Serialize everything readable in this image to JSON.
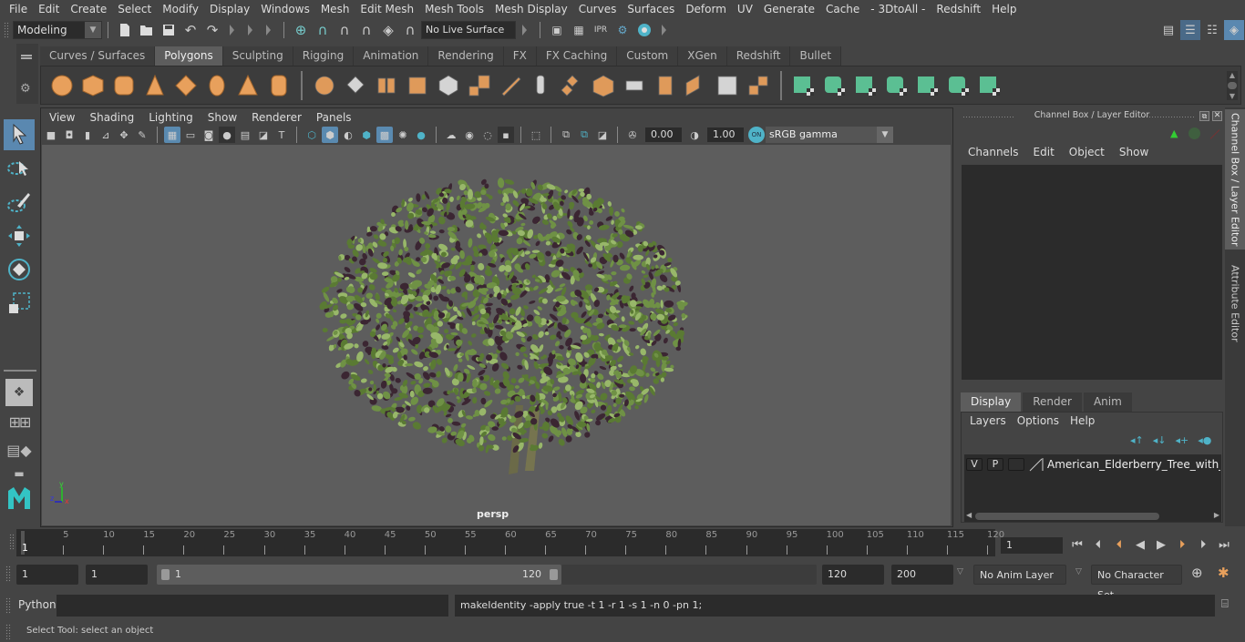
{
  "menubar": {
    "items": [
      "File",
      "Edit",
      "Create",
      "Select",
      "Modify",
      "Display",
      "Windows",
      "Mesh",
      "Edit Mesh",
      "Mesh Tools",
      "Mesh Display",
      "Curves",
      "Surfaces",
      "Deform",
      "UV",
      "Generate",
      "Cache",
      "- 3DtoAll -",
      "Redshift",
      "Help"
    ]
  },
  "statusline": {
    "mode": "Modeling",
    "live_surface": "No Live Surface"
  },
  "shelf": {
    "tabs": [
      "Curves / Surfaces",
      "Polygons",
      "Sculpting",
      "Rigging",
      "Animation",
      "Rendering",
      "FX",
      "FX Caching",
      "Custom",
      "XGen",
      "Redshift",
      "Bullet"
    ],
    "active_tab": "Polygons",
    "orange_icons": [
      "poly-sphere-icon",
      "poly-cube-icon",
      "poly-cylinder-icon",
      "poly-cone-icon",
      "poly-diamond-icon",
      "poly-torus-icon",
      "poly-pyramid-icon",
      "poly-pipe-icon"
    ],
    "mesh_icons": [
      "combine-icon",
      "separate-icon",
      "mirror-icon",
      "smooth-icon",
      "extract-icon",
      "subdivide-icon",
      "multi-cut-icon",
      "extrude-icon",
      "bridge-icon",
      "bevel-icon",
      "target-weld-icon",
      "insert-loop-icon",
      "merge-icon",
      "fill-hole-icon",
      "boolean-icon"
    ],
    "uv_icons": [
      "planar-uv-icon",
      "cylindrical-uv-icon",
      "spherical-uv-icon",
      "automatic-uv-icon",
      "unfold-uv-icon",
      "uv-editor-icon",
      "cut-sew-uv-icon"
    ],
    "accent_orange": "#e8a05c",
    "accent_green": "#5bbf93"
  },
  "viewport": {
    "menu": [
      "View",
      "Shading",
      "Lighting",
      "Show",
      "Renderer",
      "Panels"
    ],
    "exposure": "0.00",
    "gamma": "1.00",
    "color_space": "sRGB gamma",
    "camera": "persp",
    "axis": {
      "x": "x",
      "y": "y",
      "z": "z"
    }
  },
  "channel_box": {
    "title": "Channel Box / Layer Editor",
    "menu": [
      "Channels",
      "Edit",
      "Object",
      "Show"
    ]
  },
  "layer_editor": {
    "tabs": [
      "Display",
      "Render",
      "Anim"
    ],
    "active_tab": "Display",
    "menu": [
      "Layers",
      "Options",
      "Help"
    ],
    "layers": [
      {
        "v": "V",
        "p": "P",
        "name": "American_Elderberry_Tree_with_Berries"
      }
    ]
  },
  "side_tabs": [
    "Channel Box / Layer Editor",
    "Attribute Editor"
  ],
  "timeline": {
    "ticks": [
      5,
      10,
      15,
      20,
      25,
      30,
      35,
      40,
      45,
      50,
      55,
      60,
      65,
      70,
      75,
      80,
      85,
      90,
      95,
      100,
      105,
      110,
      115,
      120
    ],
    "current_label": "1",
    "current_frame": "1"
  },
  "range": {
    "start": "1",
    "playback_start": "1",
    "slider_start": "1",
    "slider_end": "120",
    "playback_end": "120",
    "end": "200",
    "anim_layer": "No Anim Layer",
    "character_set": "No Character Set"
  },
  "command": {
    "language": "Python",
    "input": "",
    "result": "makeIdentity -apply true -t 1 -r 1 -s 1 -n 0 -pn 1;"
  },
  "status": {
    "message": "Select Tool: select an object"
  }
}
